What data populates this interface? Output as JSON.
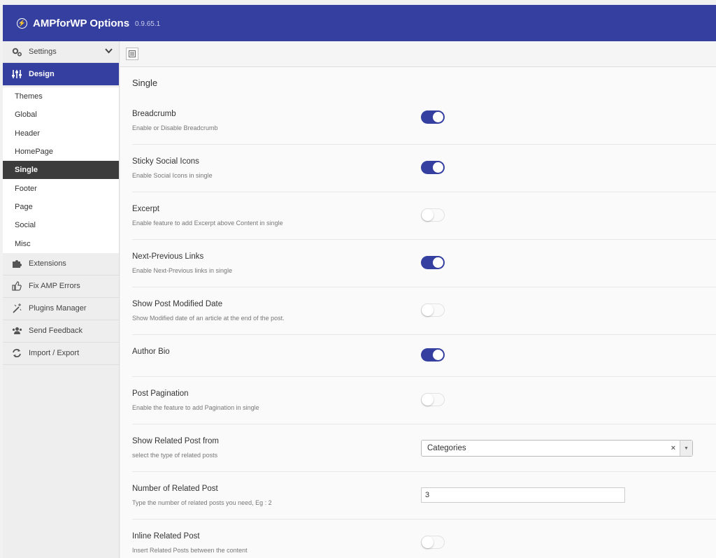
{
  "header": {
    "title": "AMPforWP Options",
    "version": "0.9.65.1"
  },
  "sidebar": {
    "settings_label": "Settings",
    "design_label": "Design",
    "submenu": [
      "Themes",
      "Global",
      "Header",
      "HomePage",
      "Single",
      "Footer",
      "Page",
      "Social",
      "Misc"
    ],
    "active_submenu": "Single",
    "bottom_items": [
      "Extensions",
      "Fix AMP Errors",
      "Plugins Manager",
      "Send Feedback",
      "Import / Export"
    ]
  },
  "main": {
    "section_title": "Single",
    "options": [
      {
        "label": "Breadcrumb",
        "desc": "Enable or Disable Breadcrumb",
        "state": "on"
      },
      {
        "label": "Sticky Social Icons",
        "desc": "Enable Social Icons in single",
        "state": "on"
      },
      {
        "label": "Excerpt",
        "desc": "Enable feature to add Excerpt above Content in single",
        "state": "off"
      },
      {
        "label": "Next-Previous Links",
        "desc": "Enable Next-Previous links in single",
        "state": "on"
      },
      {
        "label": "Show Post Modified Date",
        "desc": "Show Modified date of an article at the end of the post.",
        "state": "off"
      },
      {
        "label": "Author Bio",
        "desc": "",
        "state": "on"
      },
      {
        "label": "Post Pagination",
        "desc": "Enable the feature to add Pagination in single",
        "state": "off"
      },
      {
        "label": "Show Related Post from",
        "desc": "select the type of related posts",
        "select_value": "Categories"
      },
      {
        "label": "Number of Related Post",
        "desc": "Type the number of related posts you need, Eg : 2",
        "input_value": "3"
      },
      {
        "label": "Inline Related Post",
        "desc": "Insert Related Posts between the content",
        "state": "off"
      }
    ]
  },
  "colors": {
    "brand": "#353fa0",
    "active_submenu_bg": "#3c3c3c"
  }
}
